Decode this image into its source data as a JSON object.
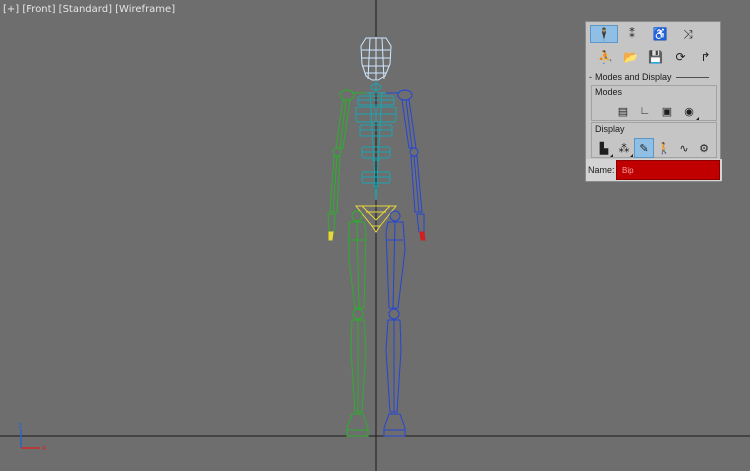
{
  "viewport": {
    "labels": [
      {
        "text": "[+]"
      },
      {
        "text": "[Front]"
      },
      {
        "text": "[Standard]"
      },
      {
        "text": "[Wireframe]"
      }
    ],
    "axis": {
      "z_label": "z",
      "x_label": "x",
      "z_color": "#2a63d1",
      "x_color": "#d12a2a"
    }
  },
  "panel": {
    "top_icons": [
      {
        "name": "biped-icon",
        "glyph": "🕴"
      },
      {
        "name": "footsteps-icon",
        "glyph": "⁑"
      },
      {
        "name": "biped-playback-icon",
        "glyph": "♿"
      },
      {
        "name": "mixer-icon",
        "glyph": "⤨"
      }
    ],
    "second_icons": [
      {
        "name": "figure-mode-icon",
        "glyph": "⛹"
      },
      {
        "name": "open-file-icon",
        "glyph": "📂"
      },
      {
        "name": "save-file-icon",
        "glyph": "💾"
      },
      {
        "name": "refresh-icon",
        "glyph": "⟳"
      },
      {
        "name": "move-all-icon",
        "glyph": "↱"
      }
    ],
    "rollout_title": "Modes and Display",
    "modes": {
      "title": "Modes",
      "buttons": [
        {
          "name": "buffer-mode-icon",
          "glyph": "▤"
        },
        {
          "name": "rubber-band-icon",
          "glyph": "∟"
        },
        {
          "name": "scale-stride-icon",
          "glyph": "▣"
        },
        {
          "name": "in-place-mode-icon",
          "glyph": "◉"
        }
      ]
    },
    "display": {
      "title": "Display",
      "buttons": [
        {
          "name": "objects-display-icon",
          "glyph": "▙"
        },
        {
          "name": "display-footsteps-icon",
          "glyph": "⁂"
        },
        {
          "name": "bones-display-icon",
          "glyph": "✎"
        },
        {
          "name": "shadow-icon",
          "glyph": "🚶"
        },
        {
          "name": "trajectories-icon",
          "glyph": "∿"
        },
        {
          "name": "preferences-icon",
          "glyph": "⚙"
        }
      ]
    },
    "name_label": "Name:",
    "name_value": "Bip"
  }
}
